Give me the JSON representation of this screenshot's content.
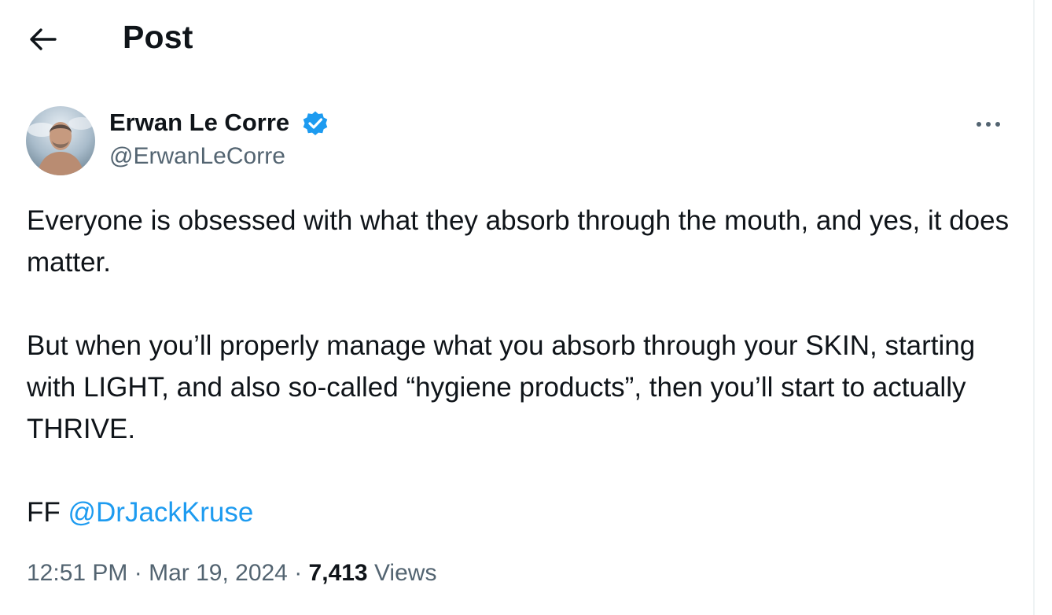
{
  "header": {
    "title": "Post",
    "back_icon": "arrow-left-icon"
  },
  "author": {
    "name": "Erwan Le Corre",
    "handle": "@ErwanLeCorre",
    "verified": true,
    "verified_icon": "verified-badge-icon",
    "avatar": "avatar-photo"
  },
  "more_icon": "more-horizontal-icon",
  "tweet": {
    "paragraphs": [
      "Everyone is obsessed with what they absorb through the mouth, and yes, it does matter.",
      "But when you’ll properly manage what you absorb through your SKIN, starting with LIGHT, and also so-called “hygiene products”, then you’ll start to actually THRIVE."
    ],
    "ff_prefix": "FF ",
    "mention": "@DrJackKruse"
  },
  "meta": {
    "time": "12:51 PM",
    "separator": " · ",
    "date": "Mar 19, 2024",
    "views_count": "7,413",
    "views_label": "Views"
  },
  "colors": {
    "text": "#0f1419",
    "secondary": "#536471",
    "accent": "#1d9bf0",
    "border": "#eff3f4"
  }
}
